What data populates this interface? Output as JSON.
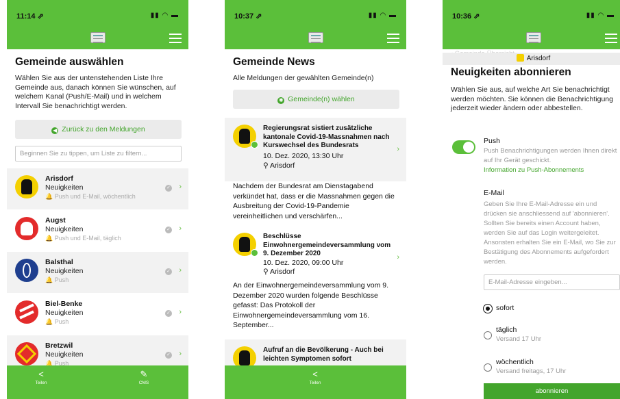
{
  "colors": {
    "brand_green": "#5bbf3a",
    "link_green": "#43a52c",
    "panel_gray": "#ebebeb"
  },
  "screen1": {
    "status": {
      "time": "11:14 ⇗",
      "icons": "▮▮ ◠ ▬"
    },
    "title": "Gemeinde auswählen",
    "intro": "Wählen Sie aus der untenstehenden Liste Ihre Gemeinde aus, danach können Sie wünschen, auf welchem Kanal (Push/E-Mail) und in welchem Intervall Sie benachrichtigt werden.",
    "back_button": "Zurück zu den Meldungen",
    "filter_placeholder": "Beginnen Sie zu tippen, um Liste zu filtern...",
    "municipalities": [
      {
        "name": "Arisdorf",
        "type": "Neuigkeiten",
        "note": "🔔 Push und E-Mail, wöchentlich",
        "crest": "yellow-black"
      },
      {
        "name": "Augst",
        "type": "Neuigkeiten",
        "note": "🔔 Push und E-Mail, täglich",
        "crest": "red-white"
      },
      {
        "name": "Balsthal",
        "type": "Neuigkeiten",
        "note": "🔔 Push",
        "crest": "blue-white"
      },
      {
        "name": "Biel-Benke",
        "type": "Neuigkeiten",
        "note": "🔔 Push",
        "crest": "red-white"
      },
      {
        "name": "Bretzwil",
        "type": "Neuigkeiten",
        "note": "🔔 Push",
        "crest": "red-yellow"
      }
    ],
    "tabs": [
      {
        "icon": "share-icon",
        "label": "Teilen"
      },
      {
        "icon": "pen-icon",
        "label": "CMS"
      }
    ]
  },
  "screen2": {
    "status": {
      "time": "10:37 ⇗",
      "icons": "▮▮ ◠ ▬"
    },
    "title": "Gemeinde News",
    "subtitle": "Alle Meldungen der gewählten Gemeinde(n)",
    "select_button": "Gemeinde(n) wählen",
    "news": [
      {
        "title": "Regierungsrat sistiert zusätzliche kantonale Covid-19-Massnahmen nach Kurswechsel des Bundesrats",
        "date": "10. Dez. 2020, 13:30 Uhr",
        "location": "Arisdorf",
        "body": "Nachdem der Bundesrat am Dienstagabend verkündet hat, dass er die Massnahmen gegen die Ausbreitung der Covid-19-Pandemie vereinheitlichen und verschärfen..."
      },
      {
        "title": "Beschlüsse Einwohnergemeindeversammlung vom 9. Dezember 2020",
        "date": "10. Dez. 2020, 09:00 Uhr",
        "location": "Arisdorf",
        "body": "An der Einwohnergemeindeversammlung vom 9. Dezember 2020 wurden folgende Beschlüsse gefasst: Das Protokoll der Einwohnergemeindeversammlung vom 16. September..."
      },
      {
        "title": "Aufruf an die Bevölkerung - Auch bei leichten Symptomen sofort",
        "date": "",
        "location": "",
        "body": ""
      }
    ],
    "tabs": [
      {
        "icon": "share-icon",
        "label": "Teilen"
      }
    ]
  },
  "screen3": {
    "status": {
      "time": "10:36 ⇗",
      "icons": "▮▮ ◠ ▬"
    },
    "back_link": "‹ Gemeinde-Übersicht",
    "municipality": "Arisdorf",
    "title": "Neuigkeiten abonnieren",
    "intro": "Wählen Sie aus, auf welche Art Sie benachrichtigt werden möchten. Sie können die Benachrichtigung jederzeit wieder ändern oder abbestellen.",
    "push": {
      "label": "Push",
      "description": "Push Benachrichtigungen werden Ihnen direkt auf Ihr Gerät geschickt.",
      "link": "Information zu Push-Abonnements",
      "enabled": true
    },
    "email": {
      "label": "E-Mail",
      "description": "Geben Sie Ihre E-Mail-Adresse ein und drücken sie anschliessend auf 'abonnieren'. Sollten Sie bereits einen Account haben, werden Sie auf das Login weitergeleitet. Ansonsten erhalten Sie ein E-Mail, wo Sie zur Bestätigung des Abonnements aufgefordert werden.",
      "placeholder": "E-Mail-Adresse eingeben..."
    },
    "intervals": [
      {
        "label": "sofort",
        "note": "",
        "selected": true
      },
      {
        "label": "täglich",
        "note": "Versand 17 Uhr",
        "selected": false
      },
      {
        "label": "wöchentlich",
        "note": "Versand freitags, 17 Uhr",
        "selected": false
      }
    ],
    "subscribe_button": "abonnieren"
  }
}
